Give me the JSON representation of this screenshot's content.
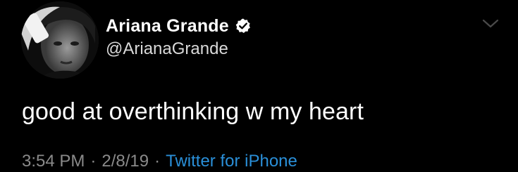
{
  "author": {
    "display_name": "Ariana Grande",
    "handle": "@ArianaGrande",
    "verified": true,
    "avatar_icon": "profile-photo"
  },
  "tweet": {
    "text": "good at overthinking w my heart",
    "time": "3:54 PM",
    "date": "2/8/19",
    "source": "Twitter for iPhone",
    "separator": "·"
  },
  "colors": {
    "background": "#000000",
    "text": "#ffffff",
    "muted": "#8a8a8a",
    "link": "#2a8fd8"
  },
  "icons": {
    "verified": "verified-badge-icon",
    "menu": "chevron-down-icon"
  }
}
